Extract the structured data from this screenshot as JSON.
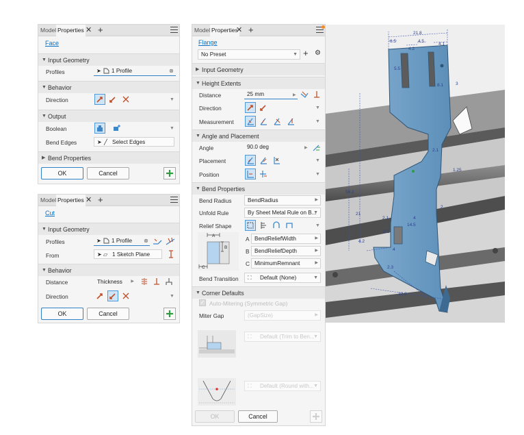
{
  "face_panel": {
    "tabs": [
      "Model",
      "Properties"
    ],
    "title": "Face",
    "sections": {
      "input_geometry": "Input Geometry",
      "behavior": "Behavior",
      "output": "Output",
      "bend_properties": "Bend Properties"
    },
    "labels": {
      "profiles": "Profiles",
      "direction": "Direction",
      "boolean": "Boolean",
      "bend_edges": "Bend Edges"
    },
    "profiles_value": "1 Profile",
    "bend_edges_value": "Select Edges",
    "ok": "OK",
    "cancel": "Cancel"
  },
  "cut_panel": {
    "tabs": [
      "Model",
      "Properties"
    ],
    "title": "Cut",
    "sections": {
      "input_geometry": "Input Geometry",
      "behavior": "Behavior"
    },
    "labels": {
      "profiles": "Profiles",
      "from": "From",
      "distance": "Distance",
      "direction": "Direction"
    },
    "profiles_value": "1 Profile",
    "from_value": "1 Sketch Plane",
    "distance_value": "Thickness",
    "ok": "OK",
    "cancel": "Cancel"
  },
  "flange_panel": {
    "tabs": [
      "Model",
      "Properties"
    ],
    "title": "Flange",
    "preset": "No Preset",
    "sections": {
      "input_geometry": "Input Geometry",
      "height_extents": "Height Extents",
      "angle_placement": "Angle and Placement",
      "bend_properties": "Bend Properties",
      "corner_defaults": "Corner Defaults"
    },
    "labels": {
      "distance": "Distance",
      "direction": "Direction",
      "measurement": "Measurement",
      "angle": "Angle",
      "placement": "Placement",
      "position": "Position",
      "bend_radius": "Bend Radius",
      "unfold_rule": "Unfold Rule",
      "relief_shape": "Relief Shape",
      "bend_transition": "Bend Transition",
      "miter_gap": "Miter Gap"
    },
    "distance_value": "25 mm",
    "angle_value": "90.0 deg",
    "bend_radius_value": "BendRadius",
    "unfold_rule_value": "By Sheet Metal Rule on B...",
    "relief": [
      {
        "key": "A",
        "value": "BendReliefWidth"
      },
      {
        "key": "B",
        "value": "BendReliefDepth"
      },
      {
        "key": "C",
        "value": "MinimumRemnant"
      }
    ],
    "bend_transition_value": "Default (None)",
    "auto_mitering": "Auto-Mitering (Symmetric Gap)",
    "miter_gap_value": "(GapSize)",
    "corner_trim_value": "Default (Trim to Ben...",
    "corner_round_value": "Default (Round with...",
    "ok": "OK",
    "cancel": "Cancel",
    "diagram_labels": {
      "a": "A",
      "b": "B",
      "c": "C"
    }
  },
  "viewport": {
    "dimensions": [
      "21.8",
      "6.5",
      "4.2",
      "4.5",
      "4.1",
      "5.5",
      "8.1",
      "2.1",
      "1.25",
      "56.2",
      "2.1",
      "14.5",
      "4",
      "2.1",
      "4.2",
      "4",
      "2.3",
      "32.8",
      "3",
      "2",
      "21"
    ]
  }
}
